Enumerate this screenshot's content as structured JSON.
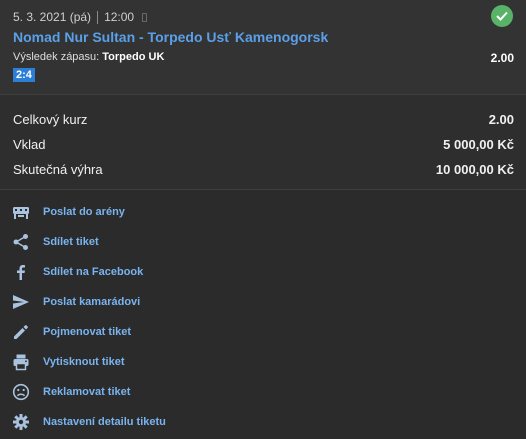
{
  "ticket": {
    "date": "5. 3. 2021 (pá)",
    "time": "12:00",
    "status_icon": "check-circle-icon",
    "match": "Nomad Nur Sultan - Torpedo Usť Kamenogorsk",
    "outcome_label": "Výsledek zápasu:",
    "outcome_value": "Torpedo UK",
    "odd": "2.00",
    "score": "2:4"
  },
  "summary": {
    "total_odds_label": "Celkový kurz",
    "total_odds_value": "2.00",
    "stake_label": "Vklad",
    "stake_value": "5 000,00 Kč",
    "win_label": "Skutečná výhra",
    "win_value": "10 000,00 Kč"
  },
  "actions": [
    {
      "label": "Poslat do arény",
      "icon": "arena-icon"
    },
    {
      "label": "Sdílet tiket",
      "icon": "share-icon"
    },
    {
      "label": "Sdílet na Facebook",
      "icon": "facebook-icon"
    },
    {
      "label": "Poslat kamarádovi",
      "icon": "send-icon"
    },
    {
      "label": "Pojmenovat tiket",
      "icon": "pencil-icon"
    },
    {
      "label": "Vytisknout tiket",
      "icon": "printer-icon"
    },
    {
      "label": "Reklamovat tiket",
      "icon": "sad-face-icon"
    },
    {
      "label": "Nastavení detailu tiketu",
      "icon": "gear-icon"
    }
  ],
  "colors": {
    "link": "#79b4f0",
    "match": "#5aa0e8",
    "success": "#58b368",
    "score_badge": "#2b7fd6",
    "icon": "#a9c2de"
  }
}
